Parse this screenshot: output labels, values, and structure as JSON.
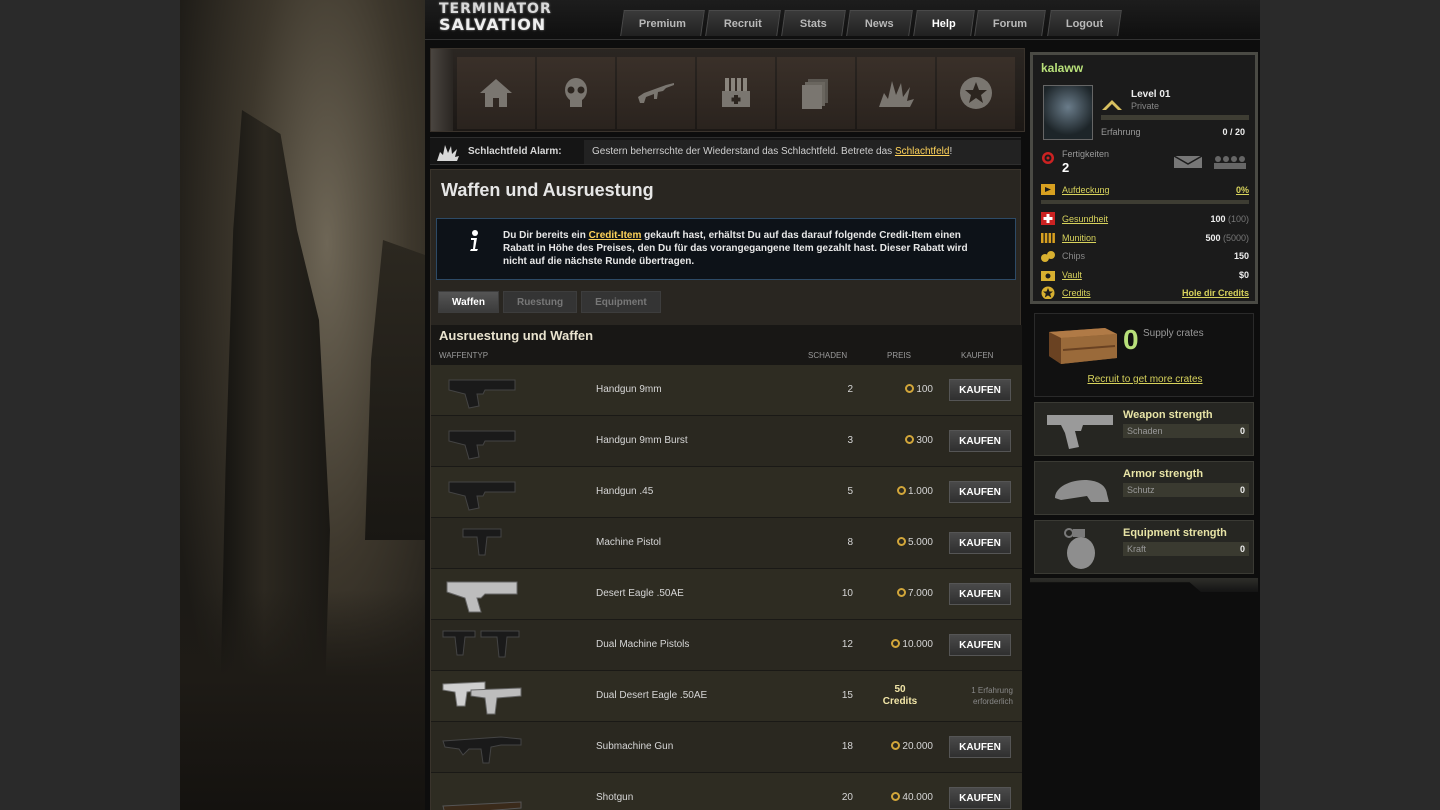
{
  "logo": {
    "line1": "TERMINATOR",
    "line2": "SALVATION"
  },
  "nav": [
    {
      "label": "Premium"
    },
    {
      "label": "Recruit"
    },
    {
      "label": "Stats"
    },
    {
      "label": "News"
    },
    {
      "label": "Help"
    },
    {
      "label": "Forum"
    },
    {
      "label": "Logout"
    }
  ],
  "icons": [
    "home-icon",
    "skull-icon",
    "rifle-icon",
    "ammo-crate-icon",
    "cards-icon",
    "explosion-icon",
    "star-badge-icon"
  ],
  "alarm": {
    "label": "Schlachtfeld Alarm:",
    "message": "Gestern beherrschte der Wiederstand das Schlachtfeld.  Betrete das ",
    "link": "Schlachtfeld",
    "suffix": "!"
  },
  "page": {
    "title": "Waffen und Ausruestung"
  },
  "info": {
    "part1": "Du Dir bereits ein ",
    "link": "Credit-Item",
    "part2": " gekauft hast, erhältst Du auf das darauf folgende Credit-Item einen Rabatt in Höhe des Preises, den Du für das vorangegangene Item gezahlt hast. Dieser Rabatt wird nicht auf die nächste Runde übertragen."
  },
  "tabs": [
    {
      "label": "Waffen",
      "active": true
    },
    {
      "label": "Ruestung",
      "active": false
    },
    {
      "label": "Equipment",
      "active": false
    }
  ],
  "table": {
    "title": "Ausruestung und Waffen",
    "col_type": "WAFFENTYP",
    "col_damage": "SCHADEN",
    "col_price": "PREIS",
    "col_buy": "KAUFEN",
    "rows": [
      {
        "name": "Handgun 9mm",
        "damage": "2",
        "price": "100",
        "buy": "KAUFEN",
        "kind": "pistol"
      },
      {
        "name": "Handgun 9mm Burst",
        "damage": "3",
        "price": "300",
        "buy": "KAUFEN",
        "kind": "pistol"
      },
      {
        "name": "Handgun .45",
        "damage": "5",
        "price": "1.000",
        "buy": "KAUFEN",
        "kind": "pistol"
      },
      {
        "name": "Machine Pistol",
        "damage": "8",
        "price": "5.000",
        "buy": "KAUFEN",
        "kind": "mp"
      },
      {
        "name": "Desert Eagle .50AE",
        "damage": "10",
        "price": "7.000",
        "buy": "KAUFEN",
        "kind": "eagle"
      },
      {
        "name": "Dual Machine Pistols",
        "damage": "12",
        "price": "10.000",
        "buy": "KAUFEN",
        "kind": "dualmp"
      },
      {
        "name": "Dual Desert Eagle .50AE",
        "damage": "15",
        "credits_line1": "50",
        "credits_line2": "Credits",
        "requirement": "1 Erfahrung erforderlich",
        "kind": "dualeagle"
      },
      {
        "name": "Submachine Gun",
        "damage": "18",
        "price": "20.000",
        "buy": "KAUFEN",
        "kind": "smg"
      },
      {
        "name": "Shotgun",
        "damage": "20",
        "price": "40.000",
        "buy": "KAUFEN",
        "kind": "shotgun"
      }
    ]
  },
  "profile": {
    "username": "kalaww",
    "level": "Level 01",
    "rank": "Private",
    "xp_label": "Erfahrung",
    "xp_value": "0 / 20",
    "xp_fraction": 0,
    "skills_label": "Fertigkeiten",
    "skills_value": "2",
    "recon_label": "Aufdeckung",
    "recon_value": "0%",
    "stats": [
      {
        "label": "Gesundheit",
        "value": "100",
        "max": "(100)",
        "link": true,
        "icon": "health-cross-icon"
      },
      {
        "label": "Munition",
        "value": "500",
        "max": "(5000)",
        "link": true,
        "icon": "ammo-icon"
      },
      {
        "label": "Chips",
        "value": "150",
        "max": "",
        "link": false,
        "icon": "chips-icon"
      },
      {
        "label": "Vault",
        "value": "$0",
        "max": "",
        "link": true,
        "icon": "vault-icon"
      },
      {
        "label": "Credits",
        "value": "Hole dir Credits",
        "max": "",
        "link": true,
        "icon": "credits-star-icon"
      }
    ]
  },
  "crates": {
    "count": "0",
    "label": "Supply crates",
    "link": "Recruit to get more crates"
  },
  "strengths": [
    {
      "title": "Weapon strength",
      "stat": "Schaden",
      "value": "0",
      "icon": "pistol-icon"
    },
    {
      "title": "Armor strength",
      "stat": "Schutz",
      "value": "0",
      "icon": "helmet-icon"
    },
    {
      "title": "Equipment strength",
      "stat": "Kraft",
      "value": "0",
      "icon": "grenade-icon"
    }
  ],
  "colors": {
    "accent_yellow": "#d8d35c",
    "username_green": "#b8e07a",
    "coin": "#d2a63a"
  }
}
